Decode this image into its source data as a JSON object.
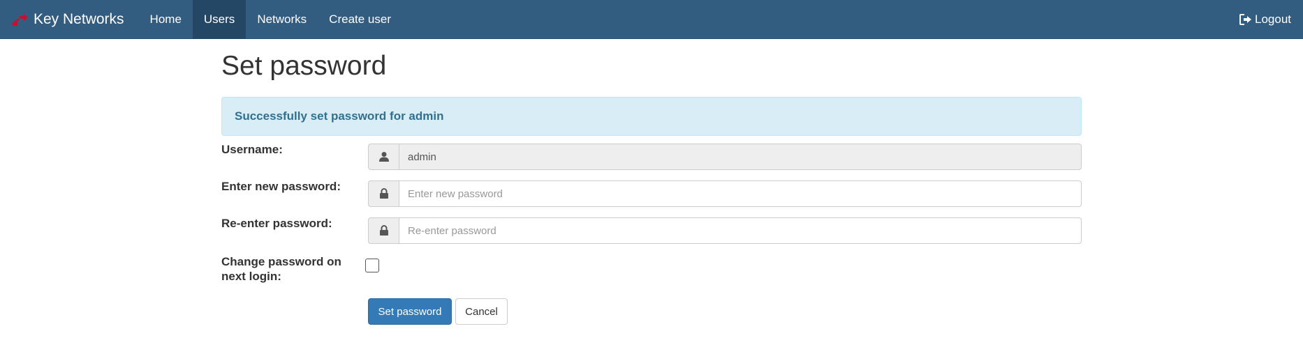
{
  "navbar": {
    "brand": "Key Networks",
    "brand_icon": "key-networks-logo",
    "items": [
      {
        "label": "Home",
        "active": false
      },
      {
        "label": "Users",
        "active": true
      },
      {
        "label": "Networks",
        "active": false
      },
      {
        "label": "Create user",
        "active": false
      }
    ],
    "logout_label": "Logout",
    "logout_icon": "logout-icon",
    "background_color": "#335c81"
  },
  "page": {
    "title": "Set password",
    "alert": "Successfully set password for admin"
  },
  "form": {
    "username": {
      "label": "Username:",
      "value": "admin",
      "icon": "user-icon"
    },
    "new_password": {
      "label": "Enter new password:",
      "value": "",
      "placeholder": "Enter new password",
      "icon": "lock-icon"
    },
    "reenter_password": {
      "label": "Re-enter password:",
      "value": "",
      "placeholder": "Re-enter password",
      "icon": "lock-icon"
    },
    "change_on_login": {
      "label_line1": "Change password on",
      "label_line2": "next login:",
      "checked": false
    },
    "submit_label": "Set password",
    "cancel_label": "Cancel"
  }
}
